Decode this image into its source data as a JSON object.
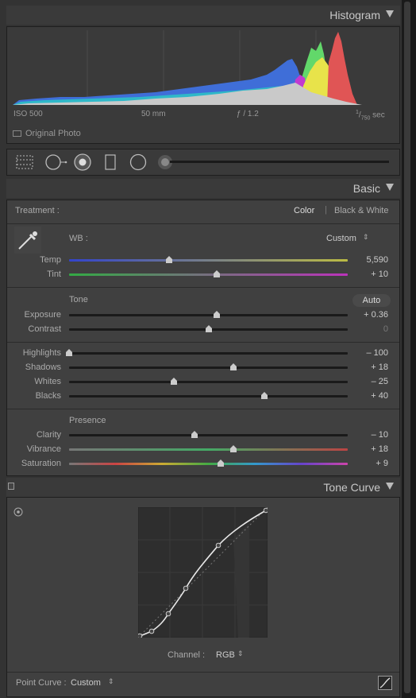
{
  "histogram": {
    "title": "Histogram",
    "iso": "ISO 500",
    "focal": "50 mm",
    "aperture": "ƒ / 1.2",
    "shutter_num": "1",
    "shutter_den": "750",
    "shutter_unit": "sec",
    "original_photo": "Original Photo"
  },
  "basic": {
    "title": "Basic",
    "treatment_label": "Treatment :",
    "color_label": "Color",
    "bw_label": "Black & White",
    "wb_label": "WB :",
    "wb_value": "Custom",
    "tone_label": "Tone",
    "auto_label": "Auto",
    "presence_label": "Presence",
    "sliders": {
      "temp": {
        "label": "Temp",
        "value": "5,590",
        "pos": 0.36
      },
      "tint": {
        "label": "Tint",
        "value": "+ 10",
        "pos": 0.53
      },
      "exposure": {
        "label": "Exposure",
        "value": "+ 0.36",
        "pos": 0.53
      },
      "contrast": {
        "label": "Contrast",
        "value": "0",
        "pos": 0.5
      },
      "highlights": {
        "label": "Highlights",
        "value": "– 100",
        "pos": 0.0
      },
      "shadows": {
        "label": "Shadows",
        "value": "+ 18",
        "pos": 0.59
      },
      "whites": {
        "label": "Whites",
        "value": "– 25",
        "pos": 0.375
      },
      "blacks": {
        "label": "Blacks",
        "value": "+ 40",
        "pos": 0.7
      },
      "clarity": {
        "label": "Clarity",
        "value": "– 10",
        "pos": 0.45
      },
      "vibrance": {
        "label": "Vibrance",
        "value": "+ 18",
        "pos": 0.59
      },
      "saturation": {
        "label": "Saturation",
        "value": "+ 9",
        "pos": 0.545
      }
    }
  },
  "tone_curve": {
    "title": "Tone Curve",
    "channel_label": "Channel :",
    "channel_value": "RGB",
    "point_curve_label": "Point Curve :",
    "point_curve_value": "Custom"
  },
  "colors": {
    "panel": "#404040",
    "header": "#3a3a3a",
    "text": "#aaaaaa"
  }
}
